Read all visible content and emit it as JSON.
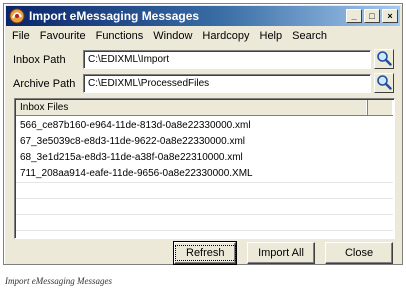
{
  "window": {
    "title": "Import eMessaging Messages",
    "controls": {
      "minimize": "_",
      "maximize": "□",
      "close": "×"
    }
  },
  "menu": [
    {
      "label": "File"
    },
    {
      "label": "Favourite"
    },
    {
      "label": "Functions"
    },
    {
      "label": "Window"
    },
    {
      "label": "Hardcopy"
    },
    {
      "label": "Help"
    },
    {
      "label": "Search"
    }
  ],
  "inbox": {
    "label": "Inbox Path",
    "value": "C:\\EDIXML\\Import"
  },
  "archive": {
    "label": "Archive Path",
    "value": "C:\\EDIXML\\ProcessedFiles"
  },
  "files": {
    "header": "Inbox Files",
    "rows": [
      "566_ce87b160-e964-11de-813d-0a8e22330000.xml",
      "67_3e5039c8-e8d3-11de-9622-0a8e22330000.xml",
      "68_3e1d215a-e8d3-11de-a38f-0a8e22310000.xml",
      "711_208aa914-eafe-11de-9656-0a8e22330000.XML"
    ]
  },
  "buttons": {
    "refresh": "Refresh",
    "import_all": "Import All",
    "close": "Close"
  },
  "caption": "Import eMessaging Messages",
  "icons": {
    "app": "app-logo-icon",
    "search": "magnifier-icon"
  }
}
